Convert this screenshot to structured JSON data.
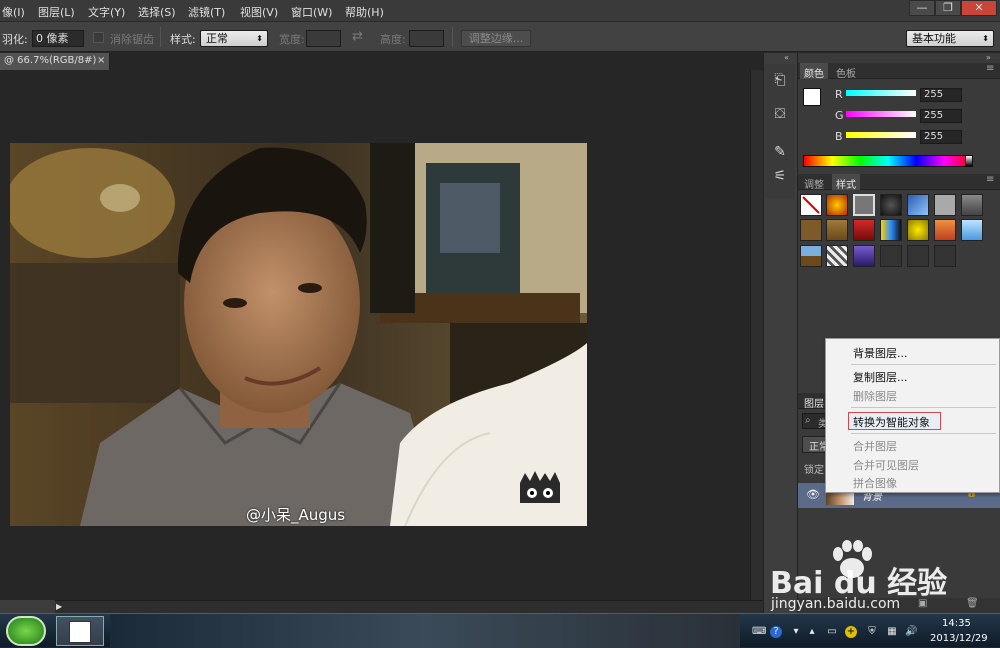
{
  "menubar": {
    "items": [
      "像(I)",
      "图层(L)",
      "文字(Y)",
      "选择(S)",
      "滤镜(T)",
      "视图(V)",
      "窗口(W)",
      "帮助(H)"
    ],
    "window_buttons": [
      "—",
      "❐",
      "✕"
    ]
  },
  "options": {
    "feather_label": "羽化:",
    "feather_value": "0 像素",
    "antialias_label": "消除锯齿",
    "style_label": "样式:",
    "style_value": "正常",
    "width_label": "宽度:",
    "height_label": "高度:",
    "refine_edge": "调整边缘...",
    "workspace": "基本功能"
  },
  "document": {
    "tab_title": "@ 66.7%(RGB/8#)",
    "tab_close": "×"
  },
  "photo": {
    "watermark": "@小呆_Augus"
  },
  "color_panel": {
    "tabs": [
      "颜色",
      "色板"
    ],
    "channels": [
      {
        "label": "R",
        "value": "255"
      },
      {
        "label": "G",
        "value": "255"
      },
      {
        "label": "B",
        "value": "255"
      }
    ]
  },
  "styles_panel": {
    "tabs": [
      "调整",
      "样式"
    ]
  },
  "layers_panel": {
    "tab": "图层",
    "search_hint": "类",
    "blend": "正常",
    "lock_label": "锁定",
    "layer_name": "背景"
  },
  "context_menu": {
    "items": [
      {
        "label": "背景图层...",
        "disabled": false
      },
      {
        "label": "复制图层...",
        "disabled": false
      },
      {
        "label": "删除图层",
        "disabled": true
      },
      {
        "label": "转换为智能对象",
        "disabled": false
      },
      {
        "label": "合并图层",
        "disabled": true
      },
      {
        "label": "合并可见图层",
        "disabled": true
      },
      {
        "label": "拼合图像",
        "disabled": true
      }
    ]
  },
  "taskbar": {
    "time": "14:35",
    "date": "2013/12/29"
  },
  "watermark_site": {
    "logo": "Bai du 经验",
    "url": "jingyan.baidu.com"
  },
  "colors": {
    "chrome_dark": "#262626",
    "panel": "#3a3a3a",
    "highlight_border": "#d24a4a"
  }
}
